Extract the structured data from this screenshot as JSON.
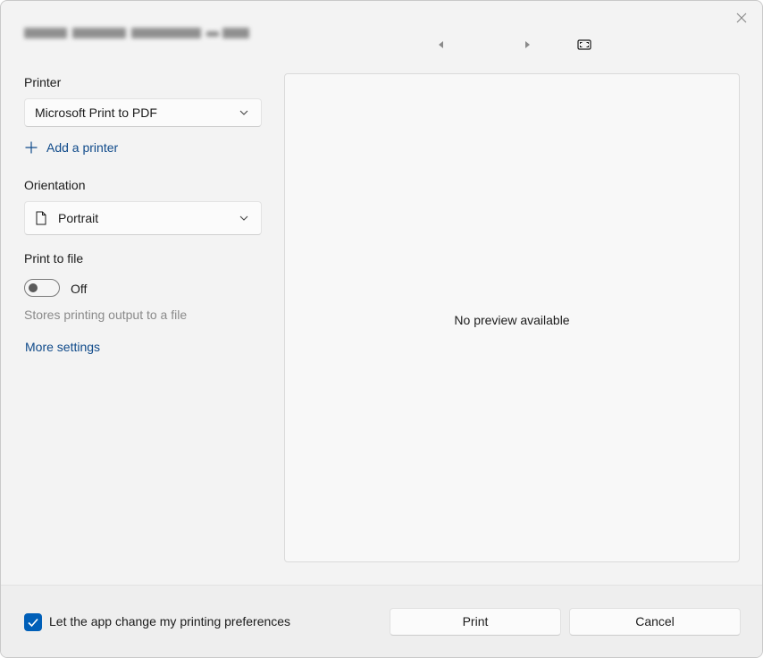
{
  "header": {
    "title_obscured": "Buying Heavy-Duty Equipment - Print",
    "close_icon": "close-icon",
    "prev_icon": "previous-page-icon",
    "next_icon": "next-page-icon",
    "fit_icon": "fit-to-window-icon"
  },
  "printer": {
    "label": "Printer",
    "selected": "Microsoft Print to PDF",
    "add_link": "Add a printer"
  },
  "orientation": {
    "label": "Orientation",
    "selected": "Portrait"
  },
  "print_to_file": {
    "label": "Print to file",
    "state": "Off",
    "hint": "Stores printing output to a file"
  },
  "more_settings": "More settings",
  "preview": {
    "message": "No preview available"
  },
  "footer": {
    "checkbox_label": "Let the app change my printing preferences",
    "checkbox_checked": true,
    "print_button": "Print",
    "cancel_button": "Cancel"
  },
  "colors": {
    "accent": "#005fb8",
    "link": "#0f4a8a",
    "background": "#f3f3f3"
  }
}
